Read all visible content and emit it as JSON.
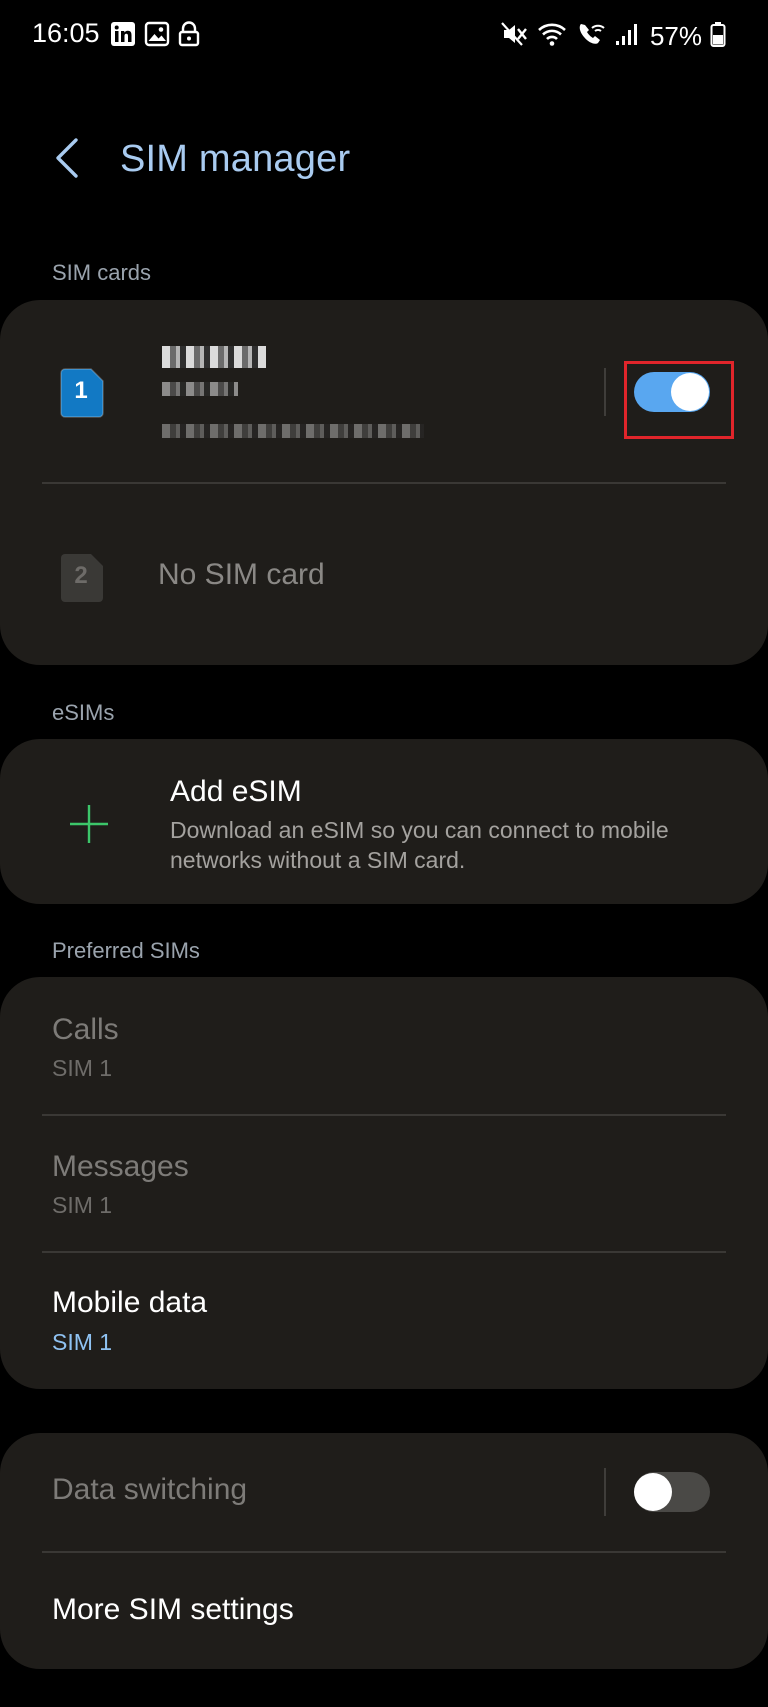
{
  "status_bar": {
    "time": "16:05",
    "left_icons": [
      "linkedin-icon",
      "gallery-icon",
      "lock-icon"
    ],
    "right_icons": [
      "mute-icon",
      "wifi-icon",
      "wifi-calling-icon",
      "signal-icon",
      "battery-icon"
    ],
    "battery": "57%"
  },
  "header": {
    "title": "SIM manager",
    "back_icon": "chevron-left-icon"
  },
  "sim_cards": {
    "section_label": "SIM cards",
    "sim1": {
      "badge": "1",
      "badge_color": "#1279c4",
      "enabled": true,
      "toggle_color": "#59a7f0"
    },
    "sim2": {
      "badge": "2",
      "label": "No SIM card"
    }
  },
  "esims": {
    "section_label": "eSIMs",
    "add": {
      "title": "Add eSIM",
      "description_line1": "Download an eSIM so you can connect to mobile",
      "description_line2": "networks without a SIM card.",
      "icon": "plus-icon",
      "icon_color": "#3cc66a"
    }
  },
  "preferred": {
    "section_label": "Preferred SIMs",
    "calls": {
      "title": "Calls",
      "value": "SIM 1"
    },
    "messages": {
      "title": "Messages",
      "value": "SIM 1"
    },
    "mobile_data": {
      "title": "Mobile data",
      "value": "SIM 1"
    }
  },
  "other": {
    "data_switching": {
      "title": "Data switching",
      "enabled": false
    },
    "more_settings": {
      "title": "More SIM settings"
    }
  }
}
